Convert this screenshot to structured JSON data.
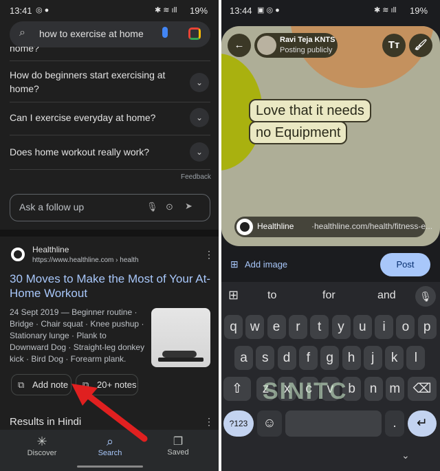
{
  "left": {
    "status": {
      "time": "13:41",
      "battery": "19%"
    },
    "search": {
      "query": "how to exercise at home"
    },
    "partial_question": "home?",
    "questions": [
      "How do beginners start exercising at home?",
      "Can I exercise everyday at home?",
      "Does home workout really work?"
    ],
    "feedback": "Feedback",
    "follow_up_placeholder": "Ask a follow up",
    "result": {
      "site": "Healthline",
      "url": "https://www.healthline.com › health",
      "title": "30 Moves to Make the Most of Your At-Home Workout",
      "snippet": "24 Sept 2019 — Beginner routine · Bridge · Chair squat · Knee pushup · Stationary lunge · Plank to Downward Dog · Straight-leg donkey kick · Bird Dog · Forearm plank.",
      "add_note": "Add note",
      "notes_count": "20+ notes"
    },
    "next_section": "Results in Hindi",
    "nav": [
      {
        "label": "Discover",
        "icon": "asterisk-icon"
      },
      {
        "label": "Search",
        "icon": "search-icon",
        "active": true
      },
      {
        "label": "Saved",
        "icon": "bookmarks-icon"
      }
    ],
    "accent": "#a8c7fa",
    "arrow_color": "#e02020"
  },
  "right": {
    "status": {
      "time": "13:44",
      "battery": "19%"
    },
    "author": {
      "name": "Ravi Teja KNTS",
      "visibility": "Posting publicly"
    },
    "text_style_button": "Tт",
    "note_text": [
      "Love that it needs",
      "no Equipment"
    ],
    "link": {
      "site": "Healthline",
      "url": "·healthline.com/health/fitness-e..."
    },
    "add_image": "Add image",
    "post": "Post",
    "suggestions": [
      "to",
      "for",
      "and"
    ],
    "keyboard": {
      "rows": [
        [
          "q",
          "w",
          "e",
          "r",
          "t",
          "y",
          "u",
          "i",
          "o",
          "p"
        ],
        [
          "a",
          "s",
          "d",
          "f",
          "g",
          "h",
          "j",
          "k",
          "l"
        ],
        [
          "z",
          "x",
          "c",
          "v",
          "b",
          "n",
          "m"
        ]
      ],
      "symbols": "?123",
      "period": "."
    },
    "watermark": "SINITC"
  }
}
